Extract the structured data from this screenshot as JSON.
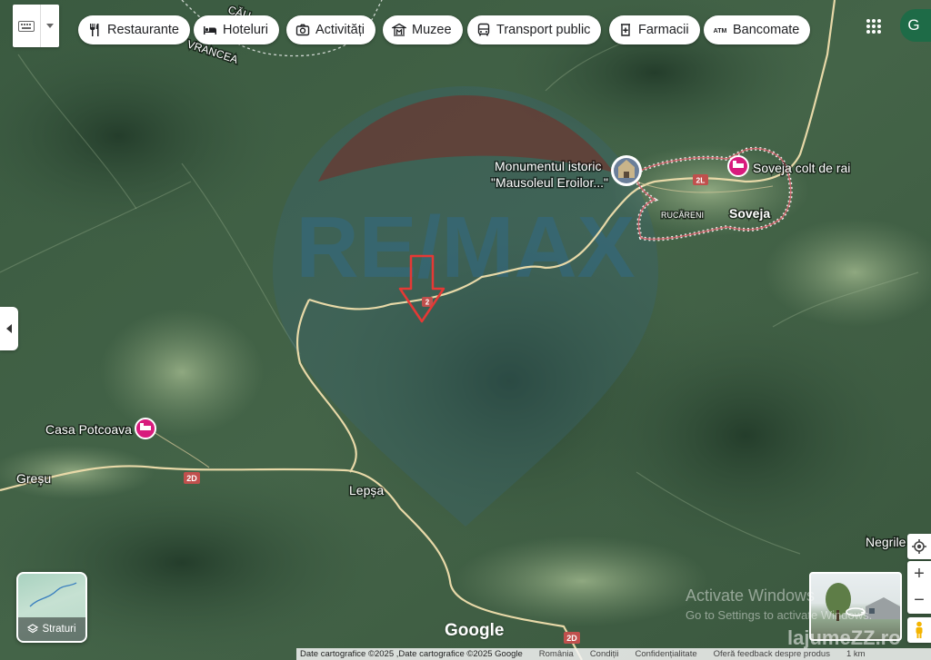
{
  "colors": {
    "terrain_dark": "#2f4b36",
    "terrain_mid": "#4a6a4e",
    "terrain_light": "#7f9a78",
    "road": "#e8d9a8",
    "marker_red": "#e53935",
    "hotel_pink": "#d81b7d",
    "route_shield": "#c0504d"
  },
  "toolbar": {
    "keyboard_icon": "keyboard-icon",
    "chips": [
      {
        "label": "Restaurante",
        "icon": "fork-knife-icon"
      },
      {
        "label": "Hoteluri",
        "icon": "bed-icon"
      },
      {
        "label": "Activități",
        "icon": "camera-icon"
      },
      {
        "label": "Muzee",
        "icon": "museum-icon"
      },
      {
        "label": "Transport public",
        "icon": "bus-icon"
      },
      {
        "label": "Farmacii",
        "icon": "pharmacy-icon"
      },
      {
        "label": "Bancomate",
        "icon": "atm-icon"
      }
    ],
    "atm_glyph": "ATM",
    "apps_icon": "apps-grid-icon",
    "avatar_initial": "G"
  },
  "map": {
    "places": {
      "monument_line1": "Monumentul istoric",
      "monument_line2": "\"Mausoleul Eroilor...\"",
      "soveja_colt": "Soveja colt de rai",
      "soveja": "Soveja",
      "rucareni": "RUCĂRENI",
      "casa_potcoava": "Casa Potcoava",
      "gresu": "Greșu",
      "lepsa": "Lepșa",
      "negrile": "Negrile",
      "vrancea": "VRANCEA",
      "cau": "CĂU"
    },
    "routes": {
      "r2l": "2L",
      "r2d_a": "2D",
      "r2d_b": "2D",
      "r2p": "2"
    },
    "watermark_brand": "RE/MAX"
  },
  "controls": {
    "layers_label": "Straturi",
    "layers_icon": "layers-icon",
    "collapse_icon": "chevron-left-icon",
    "locate_icon": "my-location-icon",
    "zoom_in": "+",
    "zoom_out": "−",
    "pegman_icon": "pegman-icon",
    "streetview_icon": "streetview-360-icon"
  },
  "overlays": {
    "google_logo": "Google",
    "activate_title": "Activate Windows",
    "activate_sub": "Go to Settings to activate Windows.",
    "site_watermark": "lajumeZZ.ro"
  },
  "footer": {
    "copyright": "Date cartografice ©2025 ,Date cartografice ©2025 Google",
    "country": "România",
    "terms": "Condiții",
    "privacy": "Confidențialitate",
    "feedback": "Oferă feedback despre produs",
    "scale": "1 km"
  }
}
